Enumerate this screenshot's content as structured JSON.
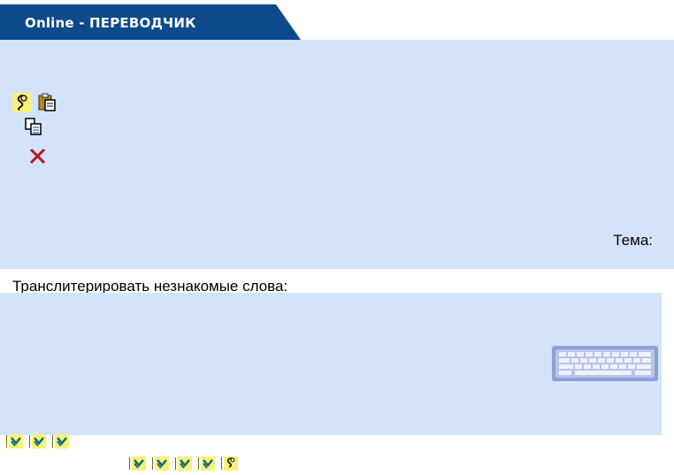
{
  "header": {
    "title": "Online - ПЕРЕВОДЧИК"
  },
  "toolbar": {
    "icons": [
      "translate-icon",
      "paste-icon",
      "copy-icon",
      "delete-icon"
    ]
  },
  "labels": {
    "topic": "Тема:",
    "transliterate": "Транслитерировать незнакомые слова:"
  },
  "colors": {
    "header_blue": "#0d4a8c",
    "panel_bg": "#d3e3fa",
    "button_yellow": "#f7f27a",
    "delete_red": "#b0171f"
  }
}
